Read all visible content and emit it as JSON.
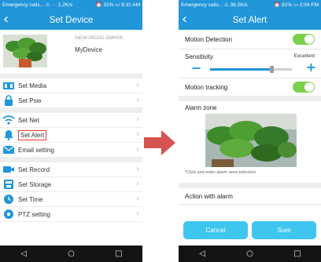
{
  "left_screen": {
    "status": {
      "left": "Emergency calls... ⚠ ··· 1.2K/s ",
      "right": "⏰ 31% ▭ 9:31 AM"
    },
    "title": "Set Device",
    "device": {
      "id": "INEW-000141-GMHXK",
      "name": "MyDevice"
    },
    "menu": [
      {
        "label": "Set Media",
        "icon": "media-icon"
      },
      {
        "label": "Set Psw",
        "icon": "lock-icon"
      },
      {
        "label": "Set Net",
        "icon": "wifi-icon"
      },
      {
        "label": "Set Alert",
        "icon": "bell-icon"
      },
      {
        "label": "Email setting",
        "icon": "mail-icon"
      },
      {
        "label": "Set Record",
        "icon": "video-camera-icon"
      },
      {
        "label": "Set Storage",
        "icon": "storage-icon"
      },
      {
        "label": "Set Time",
        "icon": "clock-icon"
      },
      {
        "label": "PTZ setting",
        "icon": "ptz-icon"
      }
    ]
  },
  "right_screen": {
    "status": {
      "left": "Emergency calls... ⚠ 38.2K/s ",
      "right": "⏰ 81% ▭ 2:04 PM"
    },
    "title": "Set Alert",
    "motion_detection": {
      "label": "Motion Detection",
      "enabled": true
    },
    "sensitivity": {
      "label": "Sensitivity",
      "value_text": "Excellent",
      "level": 0.75,
      "minus": "−",
      "plus": "+"
    },
    "motion_tracking": {
      "label": "Motion tracking",
      "enabled": true
    },
    "alarm_zone": {
      "label": "Alarm zone",
      "hint": "*Click and enter alarm area selection"
    },
    "action_with_alarm": {
      "label": "Action with alarm"
    },
    "buttons": {
      "cancel": "Cancel",
      "sure": "Sure"
    }
  },
  "nav": {
    "back": "◁",
    "home": "○",
    "recent": "□"
  },
  "colors": {
    "primary": "#2196d9",
    "accent_button": "#3ec6ef",
    "toggle_on": "#7ad14a",
    "arrow": "#d65450",
    "sure_button": "#3ec6ef"
  }
}
